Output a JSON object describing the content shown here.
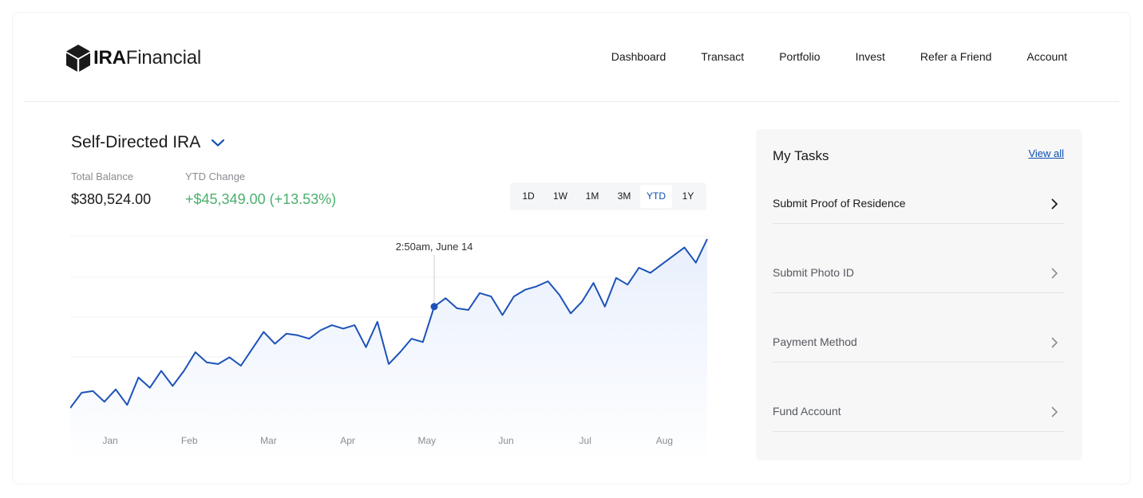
{
  "brand": {
    "bold": "IRA",
    "regular": "Financial",
    "mark_icon": "cube-logo-icon"
  },
  "nav": {
    "items": [
      {
        "label": "Dashboard",
        "active": true
      },
      {
        "label": "Transact",
        "active": false
      },
      {
        "label": "Portfolio",
        "active": false
      },
      {
        "label": "Invest",
        "active": false
      },
      {
        "label": "Refer a Friend",
        "active": false
      },
      {
        "label": "Account",
        "active": false
      }
    ]
  },
  "account": {
    "title": "Self-Directed IRA",
    "dropdown_icon": "chevron-down-icon",
    "total_balance_label": "Total Balance",
    "total_balance": "$380,524.00",
    "ytd_label": "YTD Change",
    "ytd_value": "+$45,349.00 (+13.53%)"
  },
  "range": {
    "options": [
      "1D",
      "1W",
      "1M",
      "3M",
      "YTD",
      "1Y"
    ],
    "selected": "YTD"
  },
  "colors": {
    "accent": "#0a4fb0",
    "line": "#1d52b8",
    "positive": "#4caf6e",
    "area_top": "#e8effc"
  },
  "chart_data": {
    "type": "area",
    "xlabel_ticks": [
      "Jan",
      "Feb",
      "Mar",
      "Apr",
      "May",
      "Jun",
      "Jul",
      "Aug"
    ],
    "tooltip": {
      "label": "2:50am, June 14",
      "index": 32
    },
    "values": [
      0.0,
      0.09,
      0.1,
      0.037,
      0.11,
      0.018,
      0.18,
      0.12,
      0.22,
      0.13,
      0.22,
      0.33,
      0.27,
      0.26,
      0.3,
      0.25,
      0.35,
      0.45,
      0.38,
      0.44,
      0.43,
      0.41,
      0.46,
      0.49,
      0.47,
      0.49,
      0.36,
      0.51,
      0.26,
      0.33,
      0.41,
      0.39,
      0.6,
      0.65,
      0.59,
      0.58,
      0.68,
      0.66,
      0.55,
      0.66,
      0.7,
      0.72,
      0.75,
      0.67,
      0.56,
      0.63,
      0.74,
      0.6,
      0.77,
      0.73,
      0.83,
      0.8,
      0.85,
      0.9,
      0.95,
      0.86,
      1.0
    ]
  },
  "tasks": {
    "title": "My Tasks",
    "view_all": "View all",
    "items": [
      {
        "label": "Submit Proof of Residence",
        "emphasis": true
      },
      {
        "label": "Submit Photo ID",
        "emphasis": false
      },
      {
        "label": "Payment Method",
        "emphasis": false
      },
      {
        "label": "Fund Account",
        "emphasis": false
      }
    ]
  }
}
